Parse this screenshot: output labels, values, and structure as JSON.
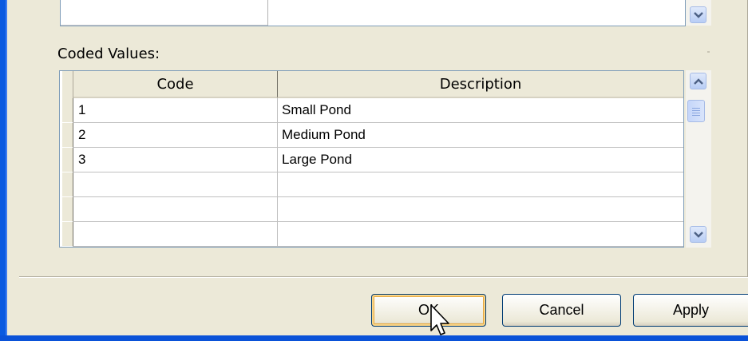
{
  "coded_values": {
    "label": "Coded Values:",
    "columns": {
      "code": "Code",
      "description": "Description"
    },
    "rows": [
      {
        "code": "1",
        "description": "Small Pond"
      },
      {
        "code": "2",
        "description": "Medium Pond"
      },
      {
        "code": "3",
        "description": "Large Pond"
      },
      {
        "code": "",
        "description": ""
      },
      {
        "code": "",
        "description": ""
      },
      {
        "code": "",
        "description": ""
      }
    ]
  },
  "buttons": {
    "ok": "OK",
    "cancel": "Cancel",
    "apply": "Apply"
  },
  "icons": {
    "scroll_up": "chevron-up-icon",
    "scroll_down": "chevron-down-icon",
    "cursor": "mouse-pointer-icon"
  },
  "colors": {
    "dialog_bg": "#ece9d8",
    "window_border": "#0a5ae0",
    "button_border": "#003c74",
    "focus_highlight": "#e7a93f"
  }
}
